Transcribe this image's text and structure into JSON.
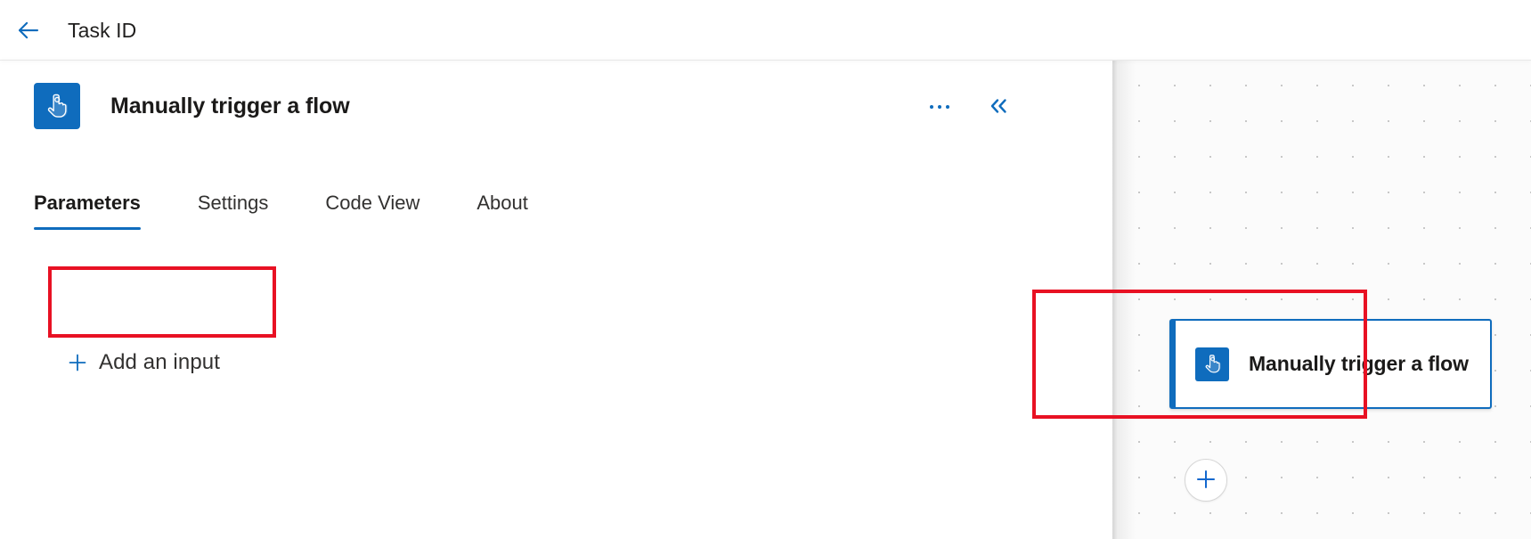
{
  "topbar": {
    "back_icon": "arrow-left-icon",
    "title": "Task ID"
  },
  "panel": {
    "icon": "manual-trigger-hand-icon",
    "title": "Manually trigger a flow",
    "more_actions_icon": "ellipsis-horizontal-icon",
    "collapse_icon": "chevron-double-left-icon",
    "tabs": [
      {
        "label": "Parameters",
        "active": true
      },
      {
        "label": "Settings",
        "active": false
      },
      {
        "label": "Code View",
        "active": false
      },
      {
        "label": "About",
        "active": false
      }
    ],
    "add_input": {
      "icon": "plus-icon",
      "label": "Add an input"
    }
  },
  "canvas": {
    "node": {
      "icon": "manual-trigger-hand-icon",
      "label": "Manually trigger a flow",
      "selected": true
    },
    "add_step": {
      "icon": "plus-icon"
    }
  },
  "annotations": [
    {
      "name": "add-input-highlight",
      "color": "#e81123"
    },
    {
      "name": "trigger-node-highlight",
      "color": "#e81123"
    }
  ],
  "colors": {
    "accent_blue": "#0f6cbd",
    "annotation_red": "#e81123",
    "text_primary": "#1b1a19",
    "canvas_bg": "#fbfbfb"
  }
}
